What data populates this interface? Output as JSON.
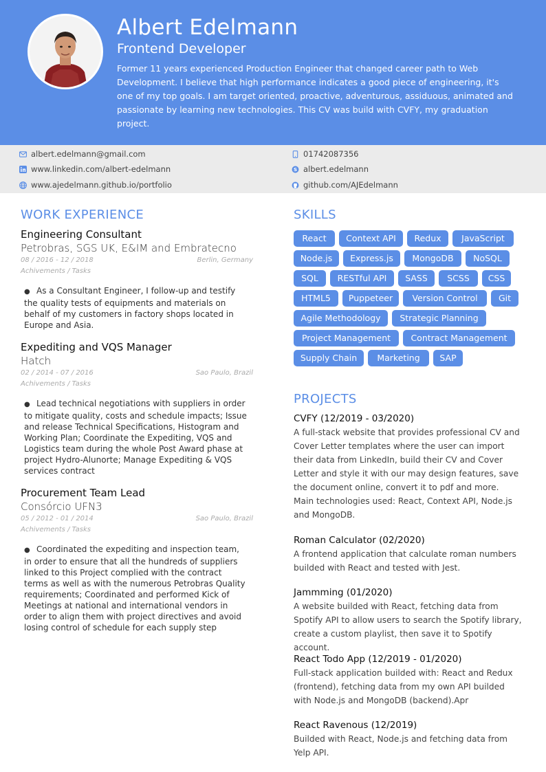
{
  "header": {
    "name": "Albert Edelmann",
    "job_title": "Frontend Developer",
    "summary": "Former 11 years experienced Production Engineer that changed career path to Web Development. I believe that high performance indicates a good piece of engineering, it's one of my top goals. I am target oriented, proactive, adventurous, assiduous, animated and passionate by learning new technologies. This CV was build with CVFY, my graduation project.",
    "photo_icon": "profile-photo"
  },
  "contact": {
    "email": "albert.edelmann@gmail.com",
    "linkedin": "www.linkedin.com/albert-edelmann",
    "portfolio": "www.ajedelmann.github.io/portfolio",
    "phone": "01742087356",
    "skype": "albert.edelmann",
    "github": "github.com/AJEdelmann"
  },
  "work": {
    "title": "WORK EXPERIENCE",
    "jobs": [
      {
        "title": "Engineering Consultant",
        "company": "Petrobras, SGS UK, E&IM and Embratecno",
        "dates": "08 / 2016 - 12 / 2018",
        "location": "Berlin, Germany",
        "achievements_label": "Achivements / Tasks",
        "description": "As a Consultant Engineer, I follow-up and testify the quality tests of equipments and materials on behalf of my customers in factory shops located in Europe and Asia."
      },
      {
        "title": "Expediting and VQS Manager",
        "company": "Hatch",
        "dates": "02 / 2014 - 07 / 2016",
        "location": "Sao Paulo, Brazil",
        "achievements_label": "Achivements / Tasks",
        "description": "Lead technical negotiations with suppliers in order to mitigate quality, costs and schedule impacts;  Issue and release Technical Specifications, Histogram and Working Plan;  Coordinate the Expediting, VQS and Logistics team during the whole Post Award phase at project Hydro-Alunorte;  Manage Expediting & VQS services contract"
      },
      {
        "title": "Procurement Team Lead",
        "company": "Consórcio UFN3",
        "dates": "05 / 2012 - 01 / 2014",
        "location": "Sao Paulo, Brazil",
        "achievements_label": "Achivements / Tasks",
        "description": "Coordinated the expediting and inspection team, in order to ensure that all the hundreds of suppliers linked to this Project complied with the contract terms as well as with the numerous Petrobras Quality requirements; Coordinated and performed Kick of Meetings at national and international vendors in order to align them with project directives and avoid losing control of schedule for each supply step"
      }
    ]
  },
  "skills": {
    "title": "SKILLS",
    "items": [
      "React",
      "Context API",
      "Redux",
      "JavaScript",
      "Node.js",
      "Express.js",
      "MongoDB",
      "NoSQL",
      "SQL",
      "RESTful API",
      "SASS",
      "SCSS",
      "CSS",
      "HTML5",
      "Puppeteer",
      "Version Control",
      "Git",
      "Agile Methodology",
      "Strategic Planning",
      "Project Management",
      "Contract Management",
      "Supply Chain",
      "Marketing",
      "SAP"
    ]
  },
  "projects": {
    "title": "PROJECTS",
    "items": [
      {
        "title": "CVFY (12/2019 - 03/2020)",
        "description": "A full-stack website that provides professional CV and Cover Letter templates where the user can import their data from LinkedIn, build their CV and Cover Letter and style it with our may design features, save the document online, convert it to pdf and more.",
        "extra": "Main technologies used: React, Context API, Node.js and MongoDB."
      },
      {
        "title": "Roman Calculator (02/2020)",
        "description": "A frontend application that calculate roman numbers builded with React and tested with Jest."
      },
      {
        "title": "Jammming (01/2020)",
        "description": "A website builded with React, fetching data from Spotify API to allow users to search the Spotify library, create a custom playlist, then save it to Spotify account."
      },
      {
        "title": "React Todo App (12/2019 - 01/2020)",
        "description": "Full-stack application builded with: React and Redux (frontend), fetching data from my own API builded with Node.js and MongoDB (backend).Apr"
      },
      {
        "title": "React Ravenous (12/2019)",
        "description": "Builded with React, Node.js and fetching data from Yelp API."
      }
    ]
  },
  "colors": {
    "accent": "#5b8ee6",
    "contact_bg": "#ebebeb"
  },
  "icons": [
    "envelope-icon",
    "linkedin-icon",
    "globe-icon",
    "phone-icon",
    "skype-icon",
    "github-icon"
  ]
}
